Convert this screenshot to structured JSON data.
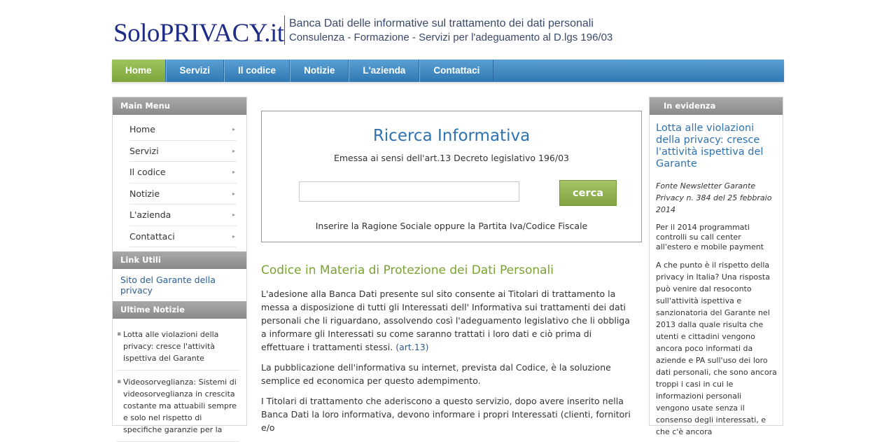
{
  "header": {
    "logo": "SoloPRIVACY.it",
    "tagline1": "Banca Dati delle informative sul trattamento dei dati personali",
    "tagline2": "Consulenza - Formazione - Servizi per l'adeguamento al D.lgs 196/03"
  },
  "nav": [
    "Home",
    "Servizi",
    "Il codice",
    "Notizie",
    "L'azienda",
    "Contattaci"
  ],
  "left": {
    "main_menu_title": "Main Menu",
    "main_menu": [
      "Home",
      "Servizi",
      "Il codice",
      "Notizie",
      "L'azienda",
      "Contattaci"
    ],
    "links_title": "Link Utili",
    "link_garante": "Sito del Garante della privacy",
    "news_title": "Ultime Notizie",
    "news": [
      "Lotta alle violazioni della privacy: cresce l'attività ispettiva del Garante",
      "Videosorveglianza: Sistemi di videosorveglianza in crescita costante ma attuabili sempre e solo nel rispetto di specifiche garanzie per la"
    ]
  },
  "search": {
    "title": "Ricerca Informativa",
    "subtitle": "Emessa ai sensi dell'art.13 Decreto legislativo 196/03",
    "input_value": "",
    "button": "cerca",
    "hint": "Inserire la Ragione Sociale oppure la Partita Iva/Codice Fiscale"
  },
  "article": {
    "title": "Codice in Materia di Protezione dei Dati Personali",
    "p1": "L'adesione alla Banca Dati presente sul sito consente ai Titolari di trattamento la messa a disposizione di tutti gli Interessati dell' Informativa sui trattamenti dei dati personali che li riguardano, assolvendo così l'adeguamento legislativo che li obbliga a informare gli Interessati su come saranno trattati i loro dati e ciò prima di effettuare i trattamenti stessi.",
    "p1_link": "(art.13)",
    "p2": "La pubblicazione dell'informativa su internet, prevista dal Codice, è la soluzione semplice ed economica per questo adempimento.",
    "p3": "I Titolari di trattamento che aderiscono a questo servizio, dopo avere inserito nella Banca Dati la loro informativa, devono informare i propri Interessati (clienti, fornitori e/o"
  },
  "right": {
    "title": "In evidenza",
    "headline": "Lotta alle violazioni della privacy: cresce l'attività ispettiva del Garante",
    "source": "Fonte Newsletter Garante Privacy n. 384 del 25 febbraio 2014",
    "p1": "Per il 2014 programmati controlli su call center all'estero e mobile payment",
    "p2": "A che punto è il rispetto della privacy in Italia? Una risposta può venire dal resoconto sull'attività ispettiva e sanzionatoria del Garante nel 2013 dalla quale risulta che utenti e cittadini vengono  ancora poco informati da aziende e PA sull'uso dei loro dati personali, che sono ancora troppi i casi in cui le informazioni personali vengono usate senza il consenso degli interessati, e che c'è ancora"
  }
}
